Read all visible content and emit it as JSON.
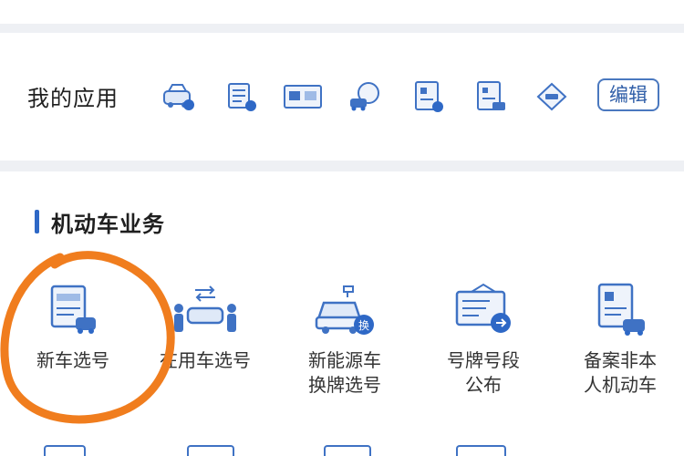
{
  "my_apps": {
    "title": "我的应用",
    "icons": [
      "car-register-icon",
      "scroll-document-icon",
      "vehicle-photo-icon",
      "car-service-icon",
      "license-certificate-icon",
      "driver-document-icon",
      "road-sign-icon"
    ],
    "edit_label": "编辑"
  },
  "motor_vehicle": {
    "title": "机动车业务",
    "services": [
      {
        "label_lines": [
          "新车选号"
        ],
        "icon": "new-car-plate-icon"
      },
      {
        "label_lines": [
          "在用车选号"
        ],
        "icon": "used-car-plate-icon"
      },
      {
        "label_lines": [
          "新能源车",
          "换牌选号"
        ],
        "icon": "ev-plate-change-icon"
      },
      {
        "label_lines": [
          "号牌号段",
          "公布"
        ],
        "icon": "plate-range-board-icon"
      },
      {
        "label_lines": [
          "备案非本",
          "人机动车"
        ],
        "icon": "record-vehicle-icon"
      }
    ],
    "ev_badge": "换"
  },
  "theme": {
    "accent": "#2e68c6",
    "annotation": "#f07d1e"
  }
}
